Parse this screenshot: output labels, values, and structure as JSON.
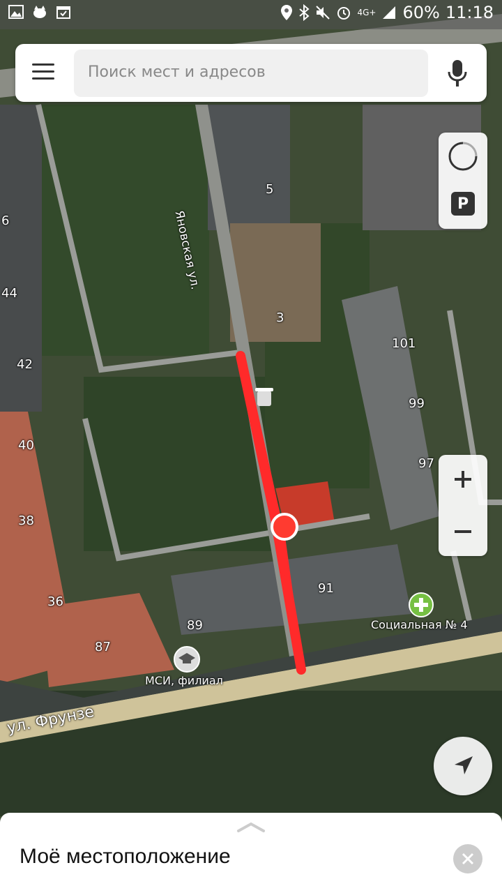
{
  "status_bar": {
    "battery": "60%",
    "time": "11:18",
    "network": "4G+",
    "icons": [
      "gallery-icon",
      "cat-icon",
      "calendar-icon",
      "location-icon",
      "bluetooth-icon",
      "mute-icon",
      "alarm-icon",
      "signal-icon",
      "battery-icon"
    ]
  },
  "search": {
    "placeholder": "Поиск мест и адресов",
    "icons": [
      "menu-icon",
      "microphone-icon"
    ]
  },
  "map": {
    "streets": {
      "yanovskaya": "Яновская ул.",
      "frunze": "ул. Фрунзе"
    },
    "house_numbers": {
      "n5": "5",
      "n6": "6",
      "n44": "44",
      "n42": "42",
      "n3": "3",
      "n101": "101",
      "n99": "99",
      "n97": "97",
      "n40": "40",
      "n38": "38",
      "n36": "36",
      "n91": "91",
      "n89": "89",
      "n87": "87"
    },
    "pois": {
      "clinic": "Социальная № 4",
      "msi": "МСИ, филиал"
    },
    "route_color": "#ff2a2a"
  },
  "controls": {
    "traffic_icon": "traffic-icon",
    "parking_label": "P",
    "zoom_in_icon": "plus-icon",
    "zoom_out_icon": "minus-icon",
    "navigation_icon": "navigation-arrow-icon"
  },
  "sheet": {
    "title": "Моё местоположение",
    "close_icon": "close-icon"
  }
}
